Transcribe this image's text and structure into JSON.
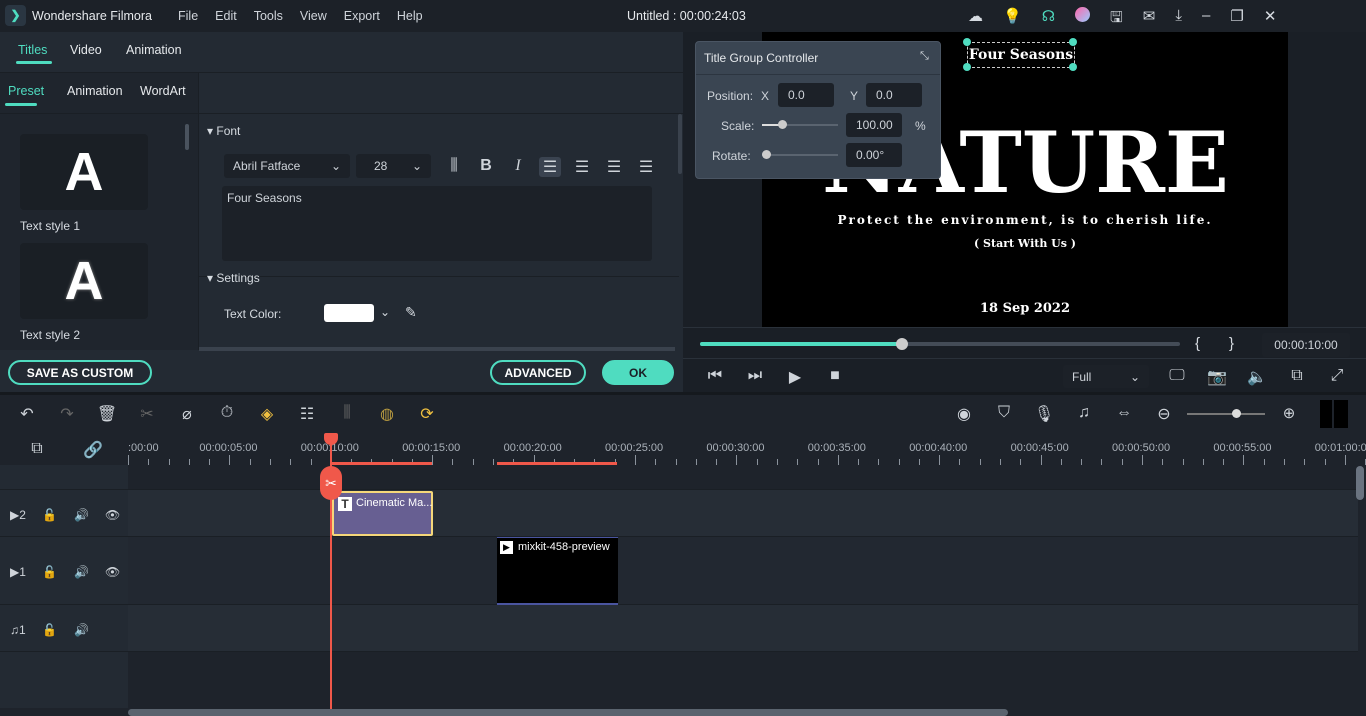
{
  "app": {
    "name": "Wondershare Filmora",
    "title": "Untitled : 00:00:24:03",
    "menu": [
      "File",
      "Edit",
      "Tools",
      "View",
      "Export",
      "Help"
    ],
    "accent": "#4fdcc0"
  },
  "left_tabs": [
    "Titles",
    "Video",
    "Animation"
  ],
  "sub_tabs": [
    "Preset",
    "Animation",
    "WordArt"
  ],
  "presets": [
    {
      "glyph": "A",
      "label": "Text style 1"
    },
    {
      "glyph": "A",
      "label": "Text style 2"
    }
  ],
  "font": {
    "section": "Font",
    "family": "Abril Fatface",
    "size": "28",
    "text": "Four Seasons"
  },
  "settings": {
    "section": "Settings",
    "text_color_label": "Text Color:",
    "text_color": "#ffffff"
  },
  "buttons": {
    "save_custom": "SAVE AS CUSTOM",
    "advanced": "ADVANCED",
    "ok": "OK"
  },
  "controller": {
    "title": "Title Group Controller",
    "position_label": "Position:",
    "x_label": "X",
    "x": "0.0",
    "y_label": "Y",
    "y": "0.0",
    "scale_label": "Scale:",
    "scale": "100.00",
    "scale_unit": "%",
    "rotate_label": "Rotate:",
    "rotate": "0.00°"
  },
  "video": {
    "top_text": "Four Seasons",
    "main": "NATURE",
    "sub": "Protect the environment, is to cherish life.",
    "tag": "( Start With Us )",
    "date": "18 Sep 2022"
  },
  "player": {
    "progress_percent": 42,
    "timecode": "00:00:10:00",
    "quality": "Full",
    "mark_in": "{",
    "mark_out": "}"
  },
  "ruler": [
    ":00:00",
    "00:00:05:00",
    "00:00:10:00",
    "00:00:15:00",
    "00:00:20:00",
    "00:00:25:00",
    "00:00:30:00",
    "00:00:35:00",
    "00:00:40:00",
    "00:00:45:00",
    "00:00:50:00",
    "00:00:55:00",
    "00:01:00:00"
  ],
  "tracks": [
    {
      "type": "video",
      "num": "2"
    },
    {
      "type": "video",
      "num": "1"
    },
    {
      "type": "audio",
      "num": "1"
    }
  ],
  "clips": {
    "title": "Cinematic Ma...",
    "video": "mixkit-458-preview"
  }
}
